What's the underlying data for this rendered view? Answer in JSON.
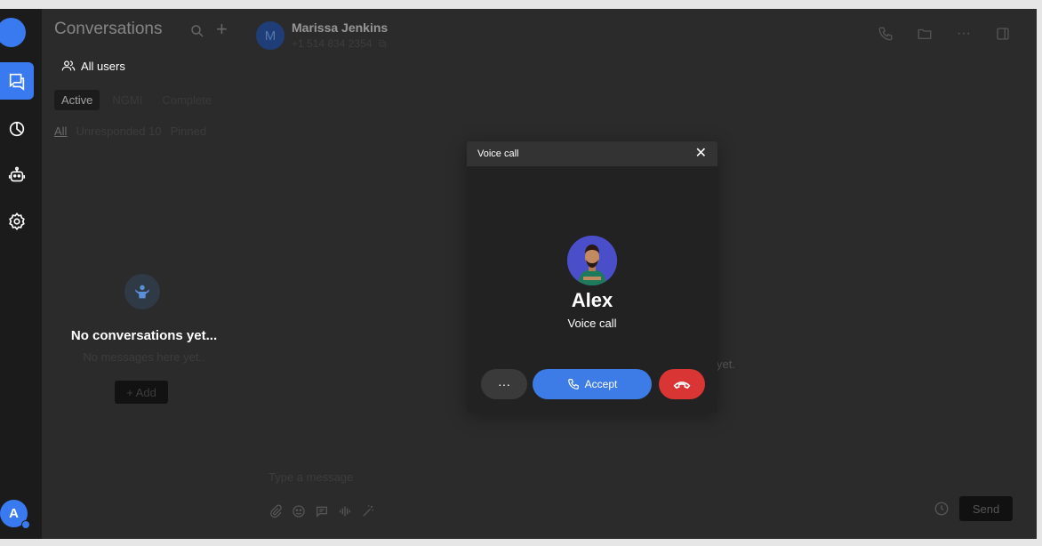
{
  "sidebar": {
    "avatar_initial": "A"
  },
  "conversations": {
    "title": "Conversations",
    "all_users": "All users",
    "segments": [
      "Active",
      "NGMI",
      "Complete"
    ],
    "filters": [
      "All",
      "Unresponded 10",
      "Pinned"
    ],
    "empty_title": "No conversations yet...",
    "empty_subtitle": "No messages here yet..",
    "add_label": "+ Add"
  },
  "chat": {
    "contact_initial": "M",
    "contact_name": "Marissa Jenkins",
    "contact_phone": "+1 514 834 2354",
    "bg_text_fragment": "yet.",
    "message_placeholder": "Type a message",
    "send_label": "Send"
  },
  "voice_call": {
    "header": "Voice call",
    "caller_name": "Alex",
    "caller_status": "Voice call",
    "more_label": "···",
    "accept_label": "Accept"
  },
  "colors": {
    "accent": "#3a7af0",
    "accept": "#3d7be6",
    "decline": "#d93535"
  }
}
